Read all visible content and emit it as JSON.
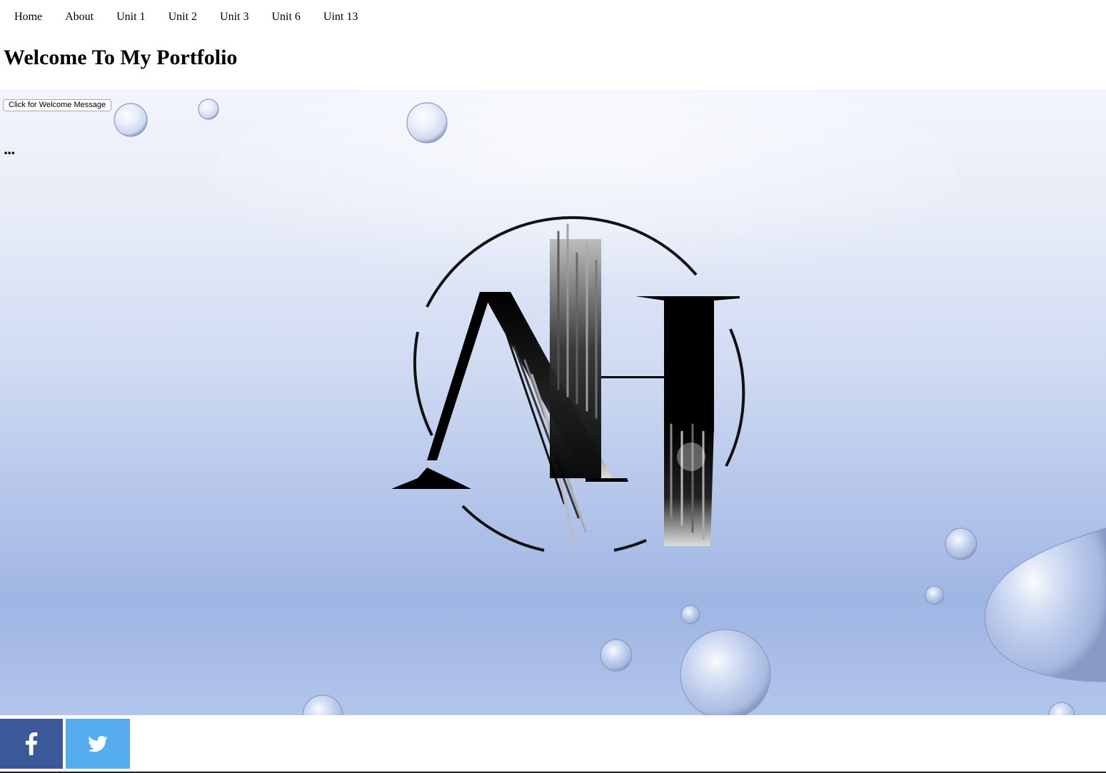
{
  "nav": {
    "items": [
      {
        "label": "Home"
      },
      {
        "label": "About"
      },
      {
        "label": "Unit 1"
      },
      {
        "label": "Unit 2"
      },
      {
        "label": "Unit 3"
      },
      {
        "label": "Unit 6"
      },
      {
        "label": "Uint 13"
      }
    ]
  },
  "page": {
    "title": "Welcome To My Portfolio"
  },
  "hero": {
    "button_label": "Click for Welcome Message",
    "message_text": "...",
    "logo": {
      "monogram": "AH",
      "ink_color": "#000000"
    },
    "background_colors": {
      "top": "#f2f5fd",
      "bottom": "#9fb5e3"
    }
  },
  "share": {
    "facebook": {
      "icon": "facebook-icon",
      "color": "#3b5998"
    },
    "twitter": {
      "icon": "twitter-icon",
      "color": "#55acee"
    }
  }
}
